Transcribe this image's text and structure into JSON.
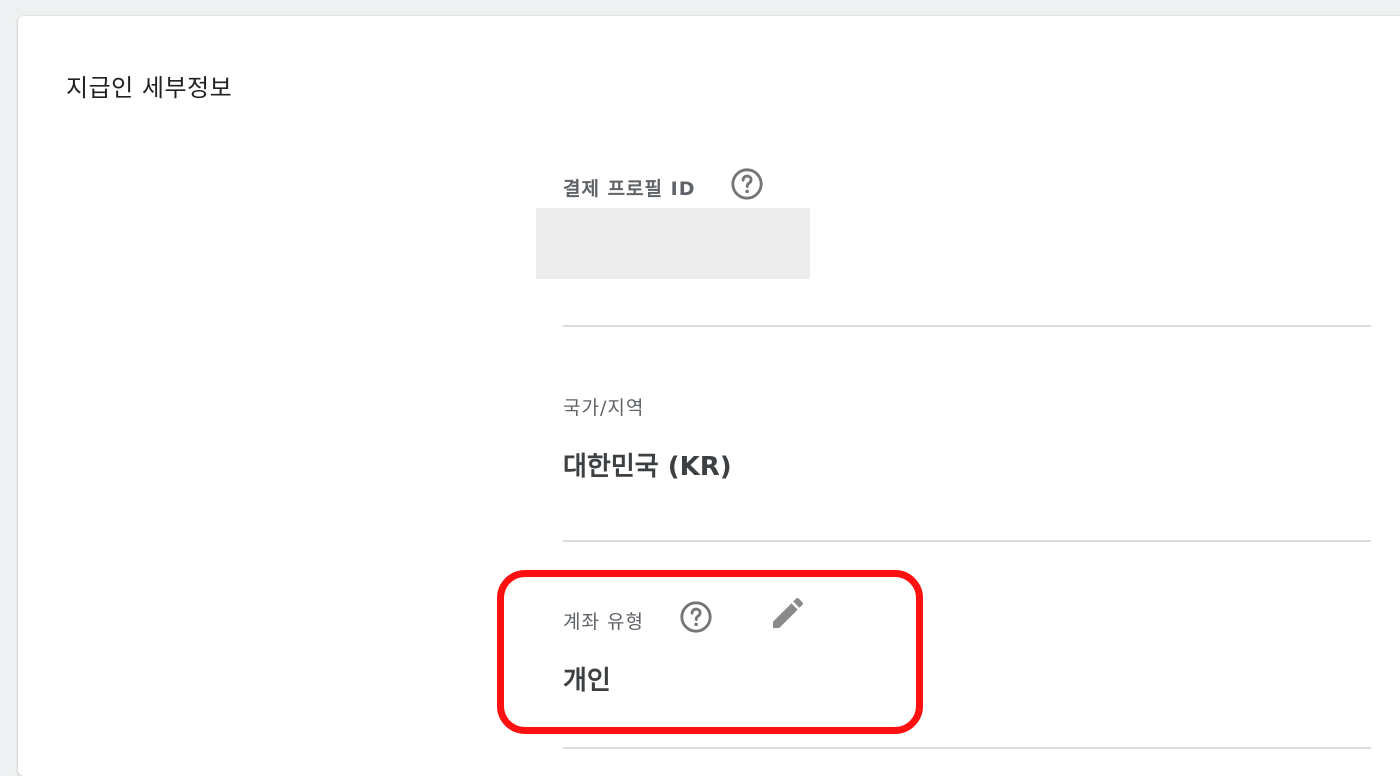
{
  "section": {
    "title": "지급인 세부정보"
  },
  "payments_profile": {
    "label": "결제 프로필 ID",
    "help_icon": "help-circle-icon",
    "value_redacted": true
  },
  "country": {
    "label": "국가/지역",
    "value": "대한민국 (KR)"
  },
  "account_type": {
    "label": "계좌 유형",
    "help_icon": "help-circle-icon",
    "edit_icon": "pencil-icon",
    "value": "개인"
  },
  "colors": {
    "highlight": "#ff1010",
    "icon": "#757575",
    "divider": "#dadce0"
  }
}
